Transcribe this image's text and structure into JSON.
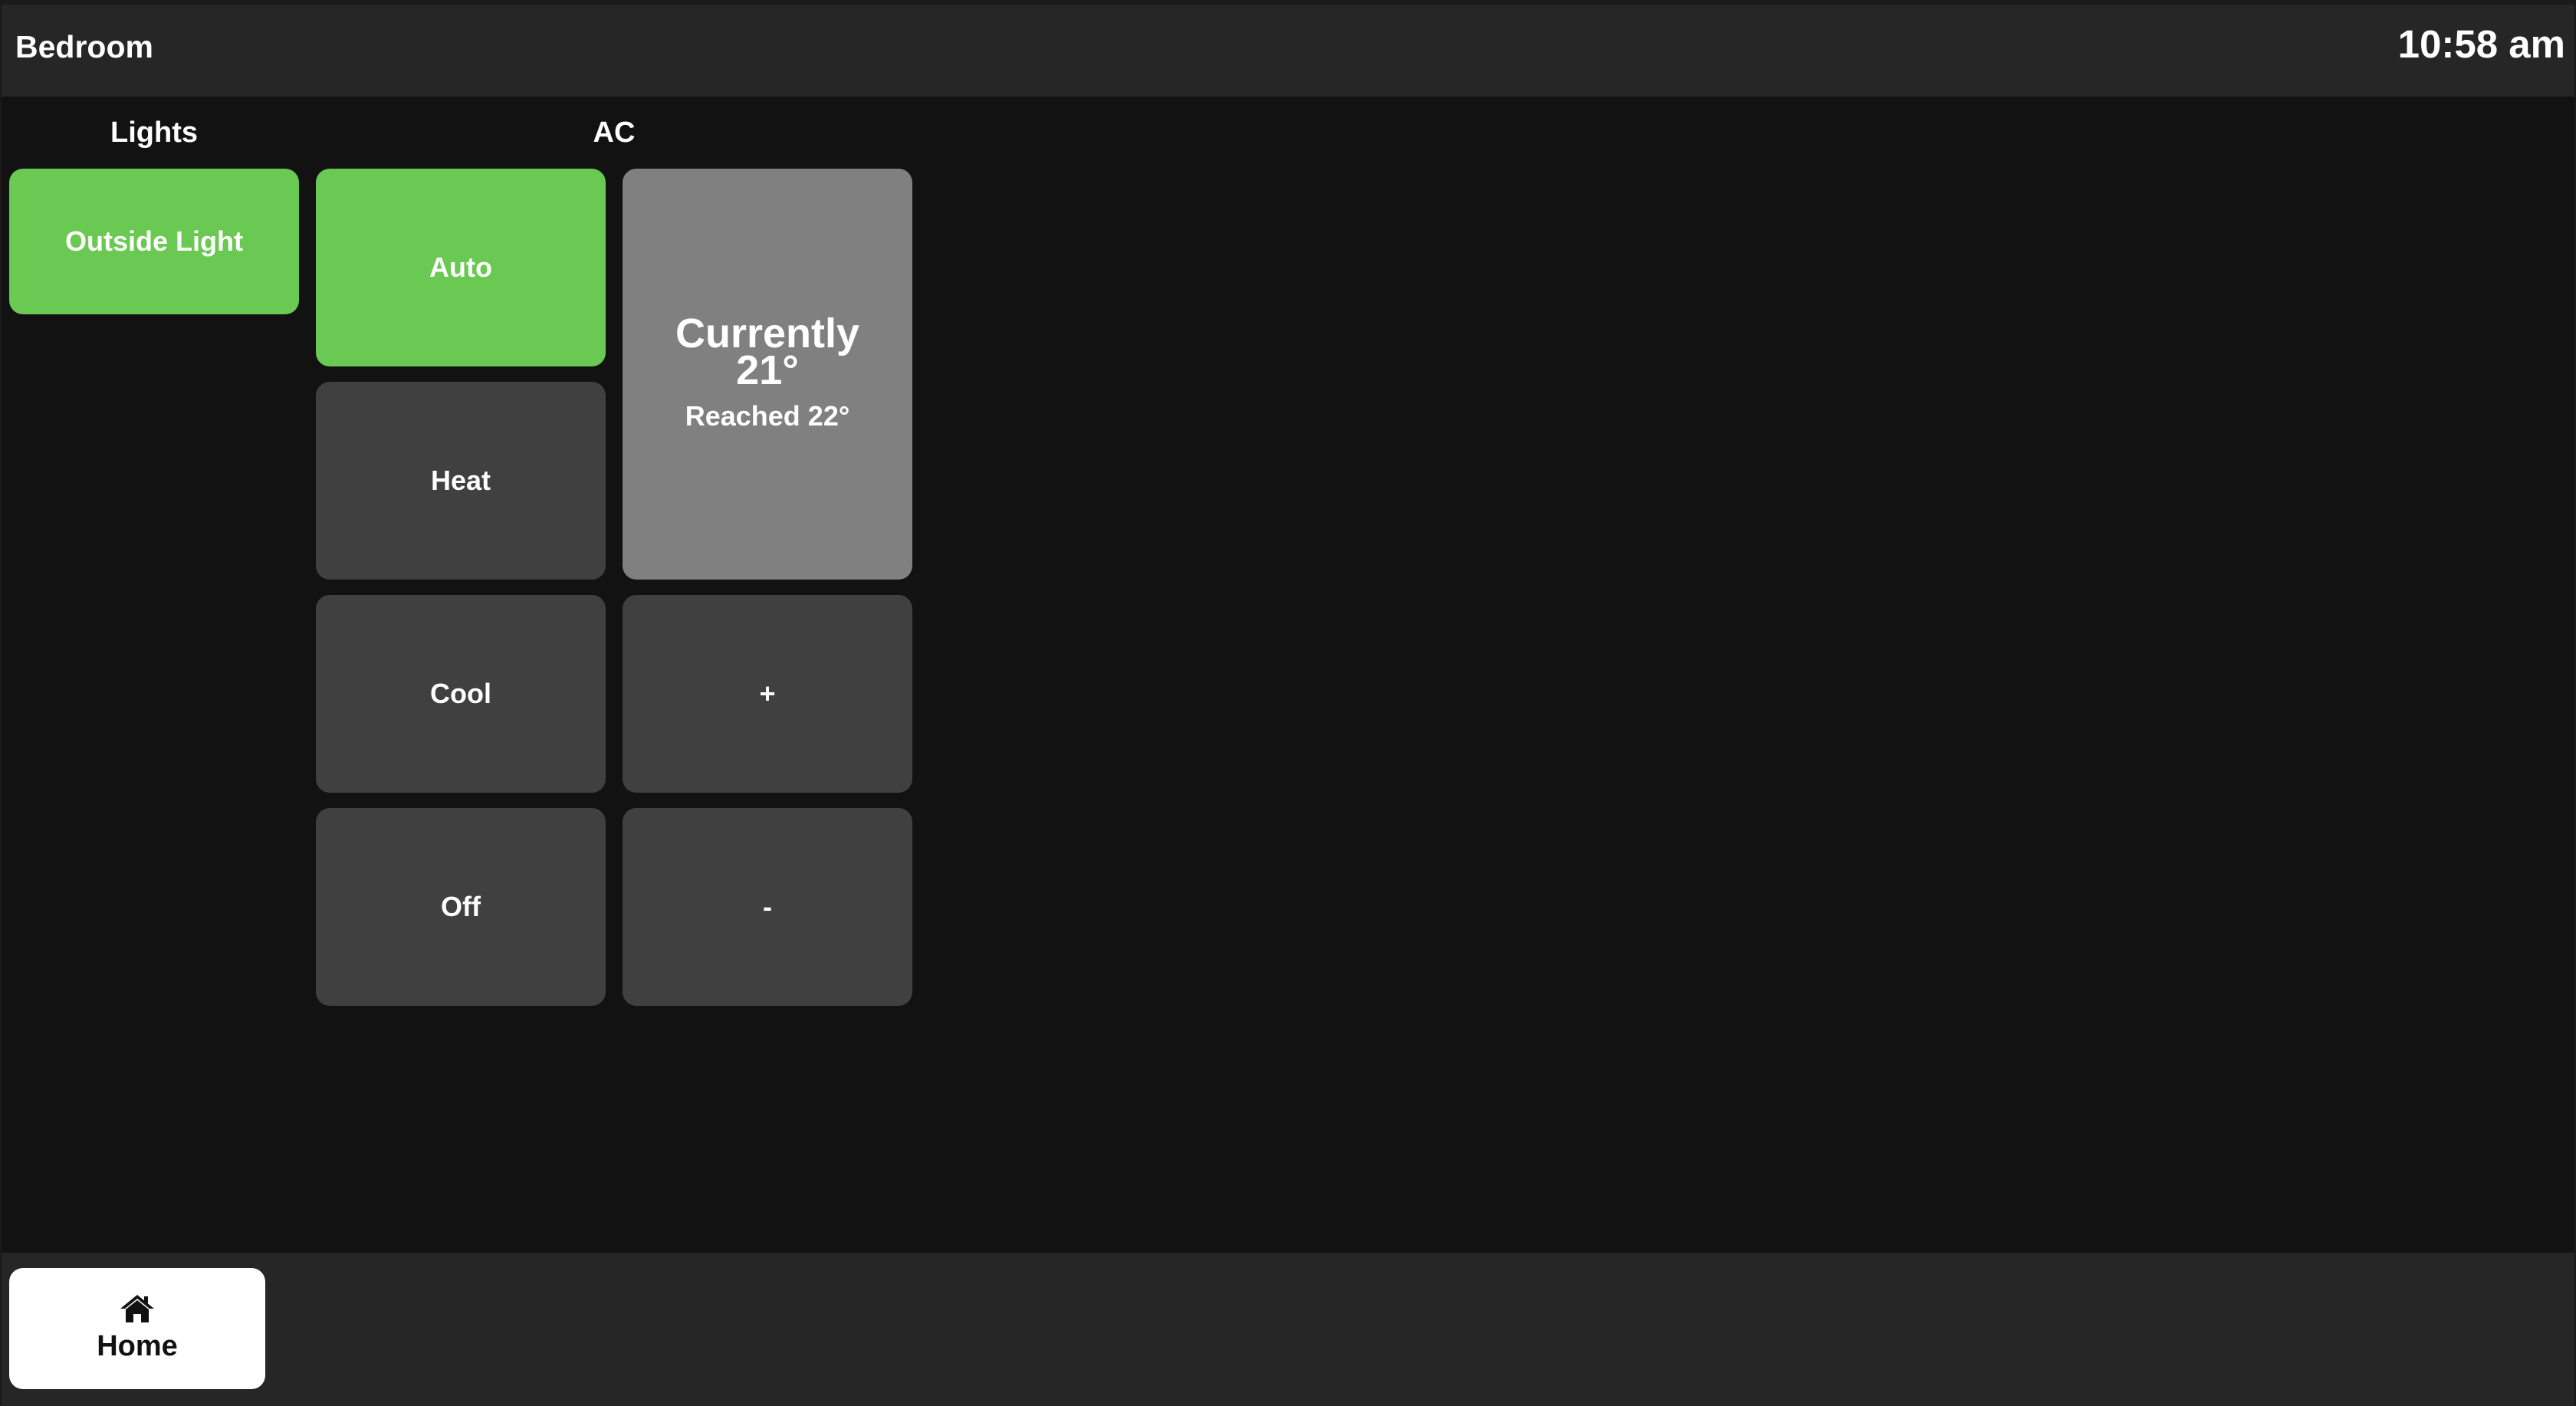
{
  "header": {
    "room": "Bedroom",
    "time": "10:58 am"
  },
  "sections": {
    "lights": "Lights",
    "ac": "AC"
  },
  "lights": {
    "outside": {
      "label": "Outside Light",
      "state": "on"
    }
  },
  "ac": {
    "modes": {
      "auto": {
        "label": "Auto",
        "state": "active"
      },
      "heat": {
        "label": "Heat",
        "state": "inactive"
      },
      "cool": {
        "label": "Cool",
        "state": "inactive"
      },
      "off": {
        "label": "Off",
        "state": "inactive"
      }
    },
    "status": {
      "currently_label": "Currently",
      "current_temp": "21°",
      "reached": "Reached 22°"
    },
    "increase_label": "+",
    "decrease_label": "-"
  },
  "footer": {
    "home_label": "Home",
    "home_icon": "home-icon"
  },
  "colors": {
    "active": "#6ac952",
    "inactive": "#404040",
    "status": "#808080",
    "header_bg": "#262626",
    "page_bg": "#121212"
  }
}
